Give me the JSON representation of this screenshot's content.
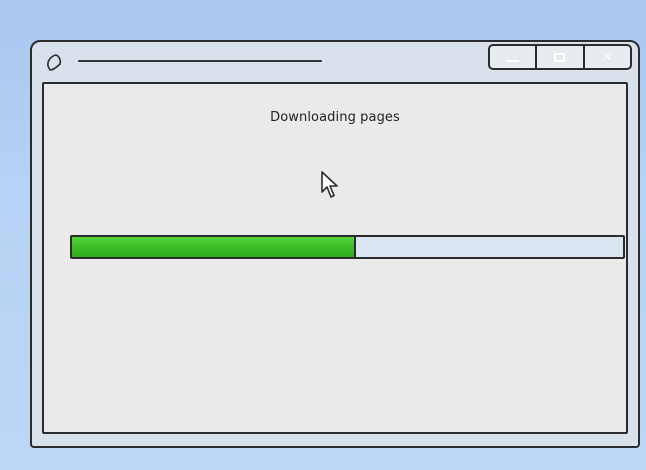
{
  "window": {
    "title": "",
    "controls": {
      "minimize_icon": "minimize-icon",
      "maximize_icon": "maximize-icon",
      "close_glyph": "×"
    }
  },
  "dialog": {
    "status_text": "Downloading pages",
    "progress": {
      "value": 0.515,
      "fill_color": "#3cbc24",
      "track_color": "#dce6f2"
    }
  },
  "colors": {
    "desktop": "#b6d2f4",
    "frame": "#d9e1ea",
    "client": "#eaeaea",
    "outline": "#2c2c2c"
  }
}
